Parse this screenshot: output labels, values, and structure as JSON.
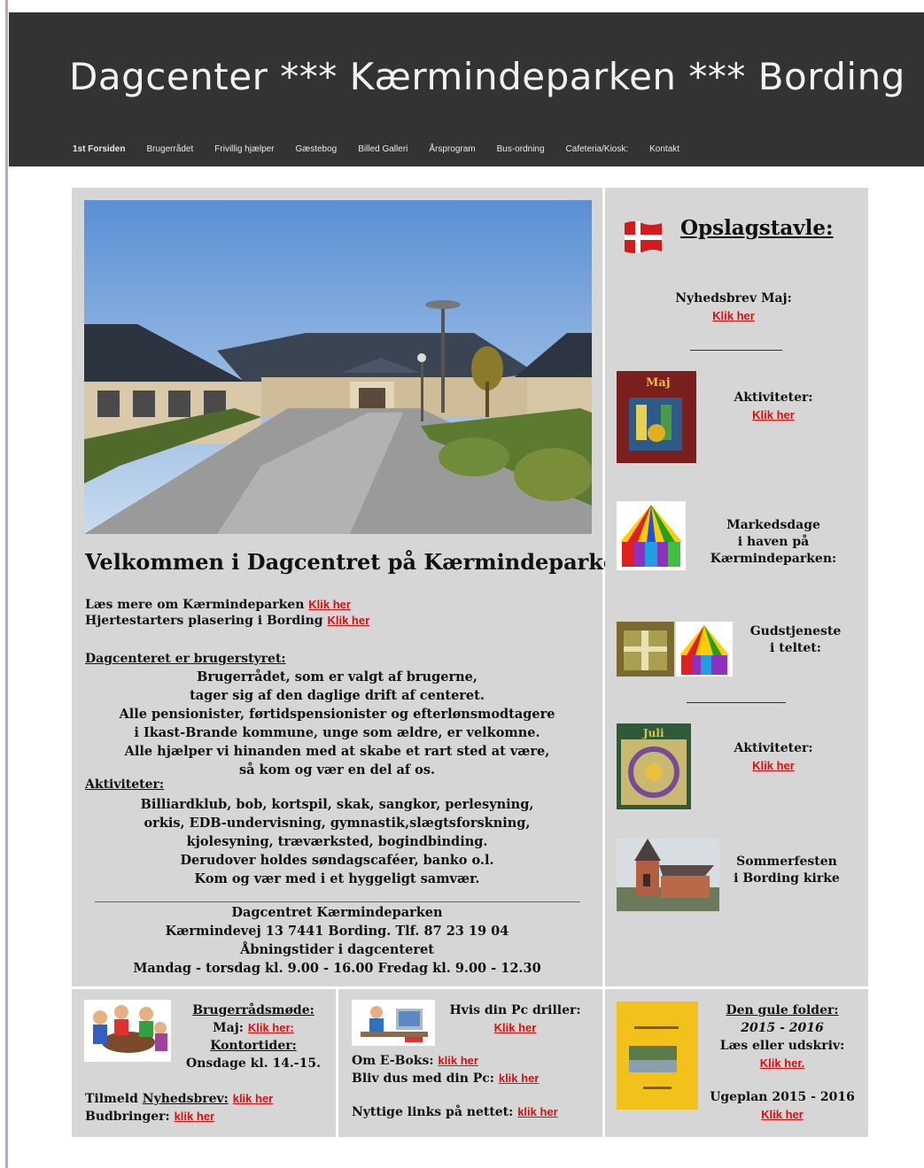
{
  "header": {
    "title": "Dagcenter *** Kærmindeparken *** Bording",
    "nav": [
      "1st Forsiden",
      "Brugerrådet",
      "Frivillig hjælper",
      "Gæstebog",
      "Billed Galleri",
      "Årsprogram",
      "Bus-ordning",
      "Cafeteria/Kiosk:",
      "Kontakt"
    ]
  },
  "main": {
    "welcome": "Velkommen i Dagcentret på Kærmindeparken",
    "intro1": "Læs mere om Kærmindeparken",
    "intro2": "Hjertestarters plasering i Bording",
    "klik": "Klik her",
    "sec1_title": "Dagcenteret er brugerstyret:",
    "sec1_lines": [
      "Brugerrådet, som er valgt af brugerne,",
      "tager sig af den daglige drift af centeret.",
      "Alle pensionister, førtidspensionister og efterlønsmodtagere",
      "i Ikast-Brande kommune, unge som ældre, er velkomne.",
      "Alle hjælper vi hinanden med at skabe et rart sted at være,",
      "så kom og vær en del af os."
    ],
    "sec2_title": "Aktiviteter:",
    "sec2_lines": [
      "Billiardklub, bob, kortspil, skak, sangkor, perlesyning,",
      "orkis, EDB-undervisning, gymnastik,slægtsforskning,",
      "kjolesyning, træværksted, bogindbinding.",
      "Derudover holdes søndagscaféer, banko o.l.",
      "Kom og vær med i et hyggeligt samvær."
    ],
    "footer_lines": [
      "Dagcentret Kærmindeparken",
      "Kærmindevej 13 7441 Bording. Tlf. 87 23 19 04",
      "Åbningstider i dagcenteret",
      "Mandag - torsdag kl. 9.00 - 16.00 Fredag kl. 9.00 - 12.30"
    ]
  },
  "sidebar": {
    "title": "Opslagstavle:",
    "nyhedsbrev": "Nyhedsbrev Maj:",
    "aktiviteter": "Aktiviteter:",
    "markedsdage": [
      "Markedsdage",
      "i haven på",
      "Kærmindeparken:"
    ],
    "gudstjeneste": [
      "Gudstjeneste",
      "i teltet:"
    ],
    "sommerfest": [
      "Sommerfesten",
      "i Bording kirke"
    ],
    "klik": "Klik her",
    "thumb_maj": "Maj",
    "thumb_juli": "Juli"
  },
  "bottom": {
    "b1_title": "Brugerrådsmøde:",
    "b1_maj": "Maj:",
    "b1_maj_link": "Klik her:",
    "b1_kontor": "Kontortider:",
    "b1_time": "Onsdage kl. 14.-15.",
    "b1_tilmeld_pre": "Tilmeld ",
    "b1_tilmeld_u": "Nyhedsbrev:",
    "b1_bud": "Budbringer:",
    "b2_pc": "Hvis din Pc driller:",
    "b2_eboks": "Om E-Boks:",
    "b2_bliv": "Bliv dus med din Pc:",
    "b2_links": "Nyttige links på nettet:",
    "b3_title": "Den gule  folder:",
    "b3_year": "2015 - 2016",
    "b3_laes": "Læs eller udskriv:",
    "b3_klik": "Klik her.",
    "b3_ugeplan": "Ugeplan 2015 - 2016",
    "klik_lower": "klik her",
    "klik": "Klik her"
  }
}
